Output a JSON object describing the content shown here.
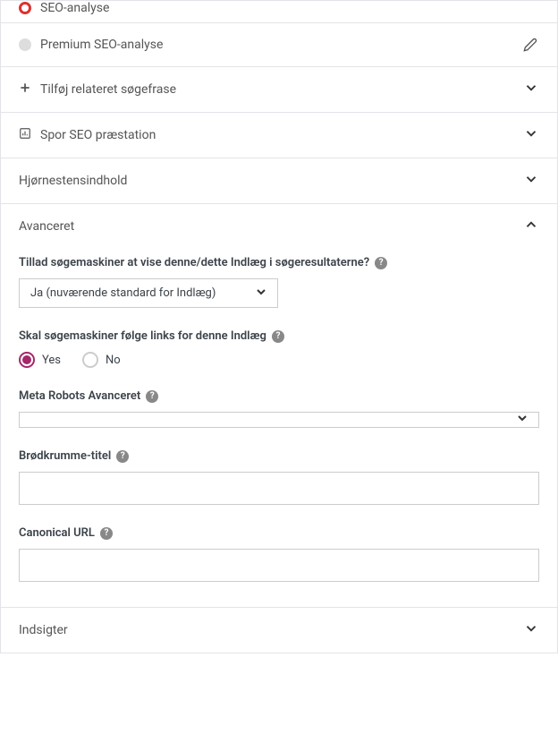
{
  "sections": {
    "seo_analyse": "SEO-analyse",
    "premium_seo": "Premium SEO-analyse",
    "add_related": "Tilføj relateret søgefrase",
    "track_seo": "Spor SEO præstation",
    "cornerstone": "Hjørnestensindhold",
    "advanced": "Avanceret",
    "insights": "Indsigter"
  },
  "advanced": {
    "allow_search_label": "Tillad søgemaskiner at vise denne/dette Indlæg i søgeresultaterne?",
    "allow_search_value": "Ja (nuværende standard for Indlæg)",
    "follow_links_label": "Skal søgemaskiner følge links for denne Indlæg",
    "follow_yes": "Yes",
    "follow_no": "No",
    "meta_robots_label": "Meta Robots Avanceret",
    "meta_robots_value": "",
    "breadcrumb_label": "Brødkrumme-titel",
    "breadcrumb_value": "",
    "canonical_label": "Canonical URL",
    "canonical_value": ""
  }
}
